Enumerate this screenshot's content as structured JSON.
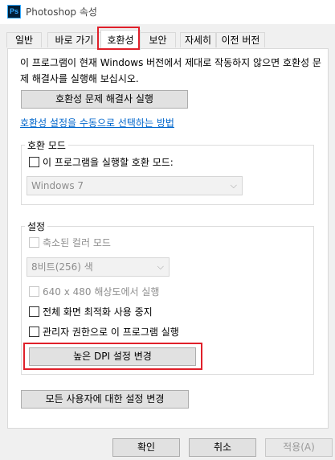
{
  "window": {
    "title": "Photoshop 속성",
    "icon": "Ps"
  },
  "tabs": [
    {
      "label": "일반"
    },
    {
      "label": "바로 가기"
    },
    {
      "label": "호환성"
    },
    {
      "label": "보안"
    },
    {
      "label": "자세히"
    },
    {
      "label": "이전 버전"
    }
  ],
  "active_tab": "호환성",
  "compat": {
    "intro": "이 프로그램이 현재 Windows 버전에서 제대로 작동하지 않으면 호환성 문제 해결사를 실행해 보십시오.",
    "troubleshooter_button": "호환성 문제 해결사 실행",
    "manual_link": "호환성 설정을 수동으로 선택하는 방법",
    "mode_group": {
      "label": "호환 모드",
      "checkbox_label": "이 프로그램을 실행할 호환 모드:",
      "checked": false,
      "select_value": "Windows 7"
    },
    "settings_group": {
      "label": "설정",
      "reduced_color": {
        "label": "축소된 컬러 모드",
        "checked": false,
        "enabled": false
      },
      "color_select": "8비트(256) 색",
      "res_640": {
        "label": "640 x 480 해상도에서 실행",
        "checked": false,
        "enabled": false
      },
      "disable_fullscreen_opt": {
        "label": "전체 화면 최적화 사용 중지",
        "checked": false
      },
      "run_as_admin": {
        "label": "관리자 권한으로 이 프로그램 실행",
        "checked": false
      },
      "high_dpi_button": "높은 DPI 설정 변경"
    },
    "all_users_button": "모든 사용자에 대한 설정 변경"
  },
  "footer": {
    "ok": "확인",
    "cancel": "취소",
    "apply": "적용(A)"
  },
  "colors": {
    "highlight": "#e0202a",
    "link": "#0066cc",
    "panel": "#ffffff",
    "window": "#f0f0f0"
  }
}
